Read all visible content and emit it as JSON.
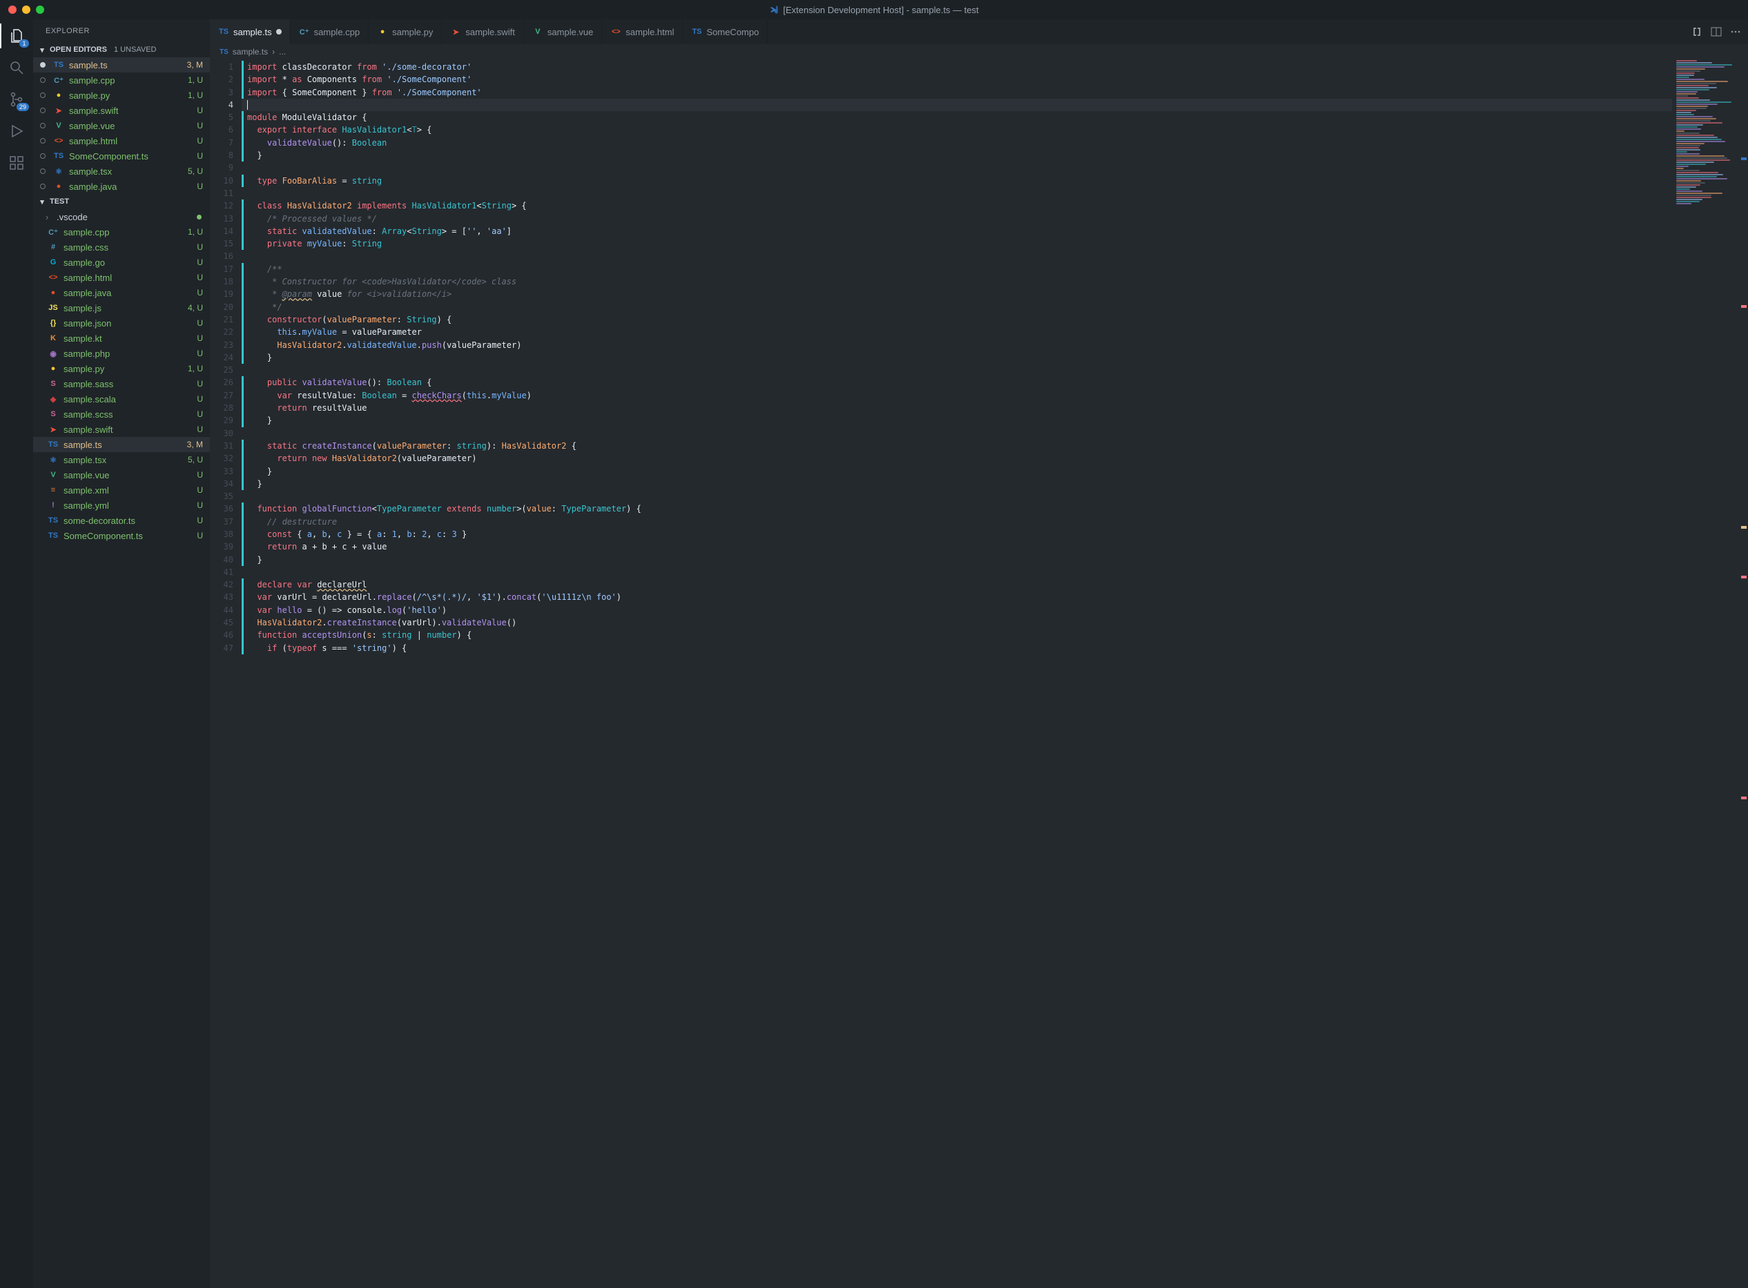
{
  "window": {
    "title": "[Extension Development Host] - sample.ts — test"
  },
  "activity": {
    "explorer_badge": "1",
    "scm_badge": "29"
  },
  "sidebar": {
    "title": "EXPLORER",
    "openEditors": {
      "label": "OPEN EDITORS",
      "unsaved": "1 UNSAVED"
    },
    "openEditorsItems": [
      {
        "name": "sample.ts",
        "icon": "TS",
        "iconClass": "ic-ts",
        "status": "3, M",
        "state": "modified",
        "dirty": true
      },
      {
        "name": "sample.cpp",
        "icon": "C⁺",
        "iconClass": "ic-cpp",
        "status": "1, U",
        "state": "untracked"
      },
      {
        "name": "sample.py",
        "icon": "●",
        "iconClass": "ic-py",
        "status": "1, U",
        "state": "untracked"
      },
      {
        "name": "sample.swift",
        "icon": "➤",
        "iconClass": "ic-swift",
        "status": "U",
        "state": "untracked"
      },
      {
        "name": "sample.vue",
        "icon": "V",
        "iconClass": "ic-vue",
        "status": "U",
        "state": "untracked"
      },
      {
        "name": "sample.html",
        "icon": "<>",
        "iconClass": "ic-html",
        "status": "U",
        "state": "untracked"
      },
      {
        "name": "SomeComponent.ts",
        "icon": "TS",
        "iconClass": "ic-ts",
        "status": "U",
        "state": "untracked"
      },
      {
        "name": "sample.tsx",
        "icon": "⚛",
        "iconClass": "ic-tsx",
        "status": "5, U",
        "state": "untracked"
      },
      {
        "name": "sample.java",
        "icon": "●",
        "iconClass": "ic-java",
        "status": "U",
        "state": "untracked"
      }
    ],
    "testSection": {
      "label": "TEST"
    },
    "folders": [
      {
        "name": ".vscode"
      }
    ],
    "files": [
      {
        "name": "sample.cpp",
        "icon": "C⁺",
        "iconClass": "ic-cpp",
        "status": "1, U",
        "state": "untracked"
      },
      {
        "name": "sample.css",
        "icon": "#",
        "iconClass": "ic-css",
        "status": "U",
        "state": "untracked"
      },
      {
        "name": "sample.go",
        "icon": "G",
        "iconClass": "ic-go",
        "status": "U",
        "state": "untracked"
      },
      {
        "name": "sample.html",
        "icon": "<>",
        "iconClass": "ic-html",
        "status": "U",
        "state": "untracked"
      },
      {
        "name": "sample.java",
        "icon": "●",
        "iconClass": "ic-java",
        "status": "U",
        "state": "untracked"
      },
      {
        "name": "sample.js",
        "icon": "JS",
        "iconClass": "ic-js",
        "status": "4, U",
        "state": "untracked"
      },
      {
        "name": "sample.json",
        "icon": "{}",
        "iconClass": "ic-json",
        "status": "U",
        "state": "untracked"
      },
      {
        "name": "sample.kt",
        "icon": "K",
        "iconClass": "ic-kt",
        "status": "U",
        "state": "untracked"
      },
      {
        "name": "sample.php",
        "icon": "◉",
        "iconClass": "ic-php",
        "status": "U",
        "state": "untracked"
      },
      {
        "name": "sample.py",
        "icon": "●",
        "iconClass": "ic-py",
        "status": "1, U",
        "state": "untracked"
      },
      {
        "name": "sample.sass",
        "icon": "S",
        "iconClass": "ic-sass",
        "status": "U",
        "state": "untracked"
      },
      {
        "name": "sample.scala",
        "icon": "◆",
        "iconClass": "ic-scala",
        "status": "U",
        "state": "untracked"
      },
      {
        "name": "sample.scss",
        "icon": "S",
        "iconClass": "ic-scss",
        "status": "U",
        "state": "untracked"
      },
      {
        "name": "sample.swift",
        "icon": "➤",
        "iconClass": "ic-swift",
        "status": "U",
        "state": "untracked"
      },
      {
        "name": "sample.ts",
        "icon": "TS",
        "iconClass": "ic-ts",
        "status": "3, M",
        "state": "modified",
        "selected": true
      },
      {
        "name": "sample.tsx",
        "icon": "⚛",
        "iconClass": "ic-tsx",
        "status": "5, U",
        "state": "untracked"
      },
      {
        "name": "sample.vue",
        "icon": "V",
        "iconClass": "ic-vue",
        "status": "U",
        "state": "untracked"
      },
      {
        "name": "sample.xml",
        "icon": "≡",
        "iconClass": "ic-xml",
        "status": "U",
        "state": "untracked"
      },
      {
        "name": "sample.yml",
        "icon": "!",
        "iconClass": "ic-yml",
        "status": "U",
        "state": "untracked"
      },
      {
        "name": "some-decorator.ts",
        "icon": "TS",
        "iconClass": "ic-ts",
        "status": "U",
        "state": "untracked"
      },
      {
        "name": "SomeComponent.ts",
        "icon": "TS",
        "iconClass": "ic-ts",
        "status": "U",
        "state": "untracked"
      }
    ]
  },
  "tabs": [
    {
      "label": "sample.ts",
      "icon": "TS",
      "iconClass": "ic-ts",
      "active": true,
      "dirty": true
    },
    {
      "label": "sample.cpp",
      "icon": "C⁺",
      "iconClass": "ic-cpp"
    },
    {
      "label": "sample.py",
      "icon": "●",
      "iconClass": "ic-py"
    },
    {
      "label": "sample.swift",
      "icon": "➤",
      "iconClass": "ic-swift"
    },
    {
      "label": "sample.vue",
      "icon": "V",
      "iconClass": "ic-vue"
    },
    {
      "label": "sample.html",
      "icon": "<>",
      "iconClass": "ic-html"
    },
    {
      "label": "SomeCompo",
      "icon": "TS",
      "iconClass": "ic-ts"
    }
  ],
  "breadcrumb": {
    "icon": "TS",
    "file": "sample.ts",
    "sep": "›",
    "rest": "..."
  },
  "code": {
    "activeLine": 4,
    "lines": [
      {
        "n": 1,
        "bar": true,
        "html": "<span class='kw'>import</span> <span class='id'>classDecorator</span> <span class='kw'>from</span> <span class='str'>'./some-decorator'</span>"
      },
      {
        "n": 2,
        "bar": true,
        "html": "<span class='kw'>import</span> <span class='pun'>*</span> <span class='kw'>as</span> <span class='id'>Components</span> <span class='kw'>from</span> <span class='str'>'./SomeComponent'</span>"
      },
      {
        "n": 3,
        "bar": true,
        "html": "<span class='kw'>import</span> <span class='pun'>{</span> <span class='id'>SomeComponent</span> <span class='pun'>}</span> <span class='kw'>from</span> <span class='str'>'./SomeComponent'</span>"
      },
      {
        "n": 4,
        "hl": true,
        "html": "<span class='pun' style='border-left:1px solid #e6edf3;'></span>"
      },
      {
        "n": 5,
        "bar": true,
        "html": "<span class='kw'>module</span> <span class='id'>ModuleValidator</span> <span class='pun'>{</span>"
      },
      {
        "n": 6,
        "bar": true,
        "html": "  <span class='kw'>export</span> <span class='kw'>interface</span> <span class='type'>HasValidator1</span><span class='pun'>&lt;</span><span class='type' style='opacity:.7'>T</span><span class='pun'>&gt; {</span>"
      },
      {
        "n": 7,
        "bar": true,
        "html": "    <span class='fn'>validateValue</span><span class='pun'>():</span> <span class='type'>Boolean</span>"
      },
      {
        "n": 8,
        "bar": true,
        "html": "  <span class='pun'>}</span>"
      },
      {
        "n": 9,
        "html": ""
      },
      {
        "n": 10,
        "bar": true,
        "html": "  <span class='kw'>type</span> <span class='cls'>FooBarAlias</span> <span class='pun'>=</span> <span class='type'>string</span>"
      },
      {
        "n": 11,
        "html": ""
      },
      {
        "n": 12,
        "bar": true,
        "html": "  <span class='kw'>class</span> <span class='cls'>HasValidator2</span> <span class='kw'>implements</span> <span class='type'>HasValidator1</span><span class='pun'>&lt;</span><span class='type'>String</span><span class='pun'>&gt; {</span>"
      },
      {
        "n": 13,
        "bar": true,
        "html": "    <span class='cm'>/* Processed values */</span>"
      },
      {
        "n": 14,
        "bar": true,
        "html": "    <span class='kw'>static</span> <span class='prop'>validatedValue</span><span class='pun'>:</span> <span class='type'>Array</span><span class='pun'>&lt;</span><span class='type'>String</span><span class='pun'>&gt; = [</span><span class='str'>''</span><span class='pun'>,</span> <span class='str'>'aa'</span><span class='pun'>]</span>"
      },
      {
        "n": 15,
        "bar": true,
        "html": "    <span class='kw'>private</span> <span class='prop'>myValue</span><span class='pun'>:</span> <span class='type'>String</span>"
      },
      {
        "n": 16,
        "html": ""
      },
      {
        "n": 17,
        "bar": true,
        "html": "    <span class='cm'>/**</span>"
      },
      {
        "n": 18,
        "bar": true,
        "html": "     <span class='cm'>* Constructor for &lt;code&gt;HasValidator&lt;/code&gt; class</span>"
      },
      {
        "n": 19,
        "bar": true,
        "html": "     <span class='cm'>* <span class='warn'>@param</span> <span style='color:#e6edf3;font-style:normal'>value</span> for &lt;i&gt;validation&lt;/i&gt;</span>"
      },
      {
        "n": 20,
        "bar": true,
        "html": "     <span class='cm'>*/</span>"
      },
      {
        "n": 21,
        "bar": true,
        "html": "    <span class='kw'>constructor</span><span class='pun'>(</span><span class='param'>valueParameter</span><span class='pun'>:</span> <span class='type'>String</span><span class='pun'>) {</span>"
      },
      {
        "n": 22,
        "bar": true,
        "html": "      <span class='this'>this</span><span class='pun'>.</span><span class='prop'>myValue</span> <span class='pun'>=</span> <span class='id'>valueParameter</span>"
      },
      {
        "n": 23,
        "bar": true,
        "html": "      <span class='cls'>HasValidator2</span><span class='pun'>.</span><span class='prop'>validatedValue</span><span class='pun'>.</span><span class='fn'>push</span><span class='pun'>(</span><span class='id'>valueParameter</span><span class='pun'>)</span>"
      },
      {
        "n": 24,
        "bar": true,
        "html": "    <span class='pun'>}</span>"
      },
      {
        "n": 25,
        "html": ""
      },
      {
        "n": 26,
        "bar": true,
        "html": "    <span class='kw'>public</span> <span class='fn'>validateValue</span><span class='pun'>():</span> <span class='type'>Boolean</span> <span class='pun'>{</span>"
      },
      {
        "n": 27,
        "bar": true,
        "html": "      <span class='kw'>var</span> <span class='id'>resultValue</span><span class='pun'>:</span> <span class='type'>Boolean</span> <span class='pun'>=</span> <span class='fn err'>checkChars</span><span class='pun'>(</span><span class='this'>this</span><span class='pun'>.</span><span class='prop'>myValue</span><span class='pun'>)</span>"
      },
      {
        "n": 28,
        "bar": true,
        "html": "      <span class='kw'>return</span> <span class='id'>resultValue</span>"
      },
      {
        "n": 29,
        "bar": true,
        "html": "    <span class='pun'>}</span>"
      },
      {
        "n": 30,
        "html": ""
      },
      {
        "n": 31,
        "bar": true,
        "html": "    <span class='kw'>static</span> <span class='fn'>createInstance</span><span class='pun'>(</span><span class='param'>valueParameter</span><span class='pun'>:</span> <span class='type'>string</span><span class='pun'>):</span> <span class='cls'>HasValidator2</span> <span class='pun'>{</span>"
      },
      {
        "n": 32,
        "bar": true,
        "html": "      <span class='kw'>return</span> <span class='kw'>new</span> <span class='cls'>HasValidator2</span><span class='pun'>(</span><span class='id'>valueParameter</span><span class='pun'>)</span>"
      },
      {
        "n": 33,
        "bar": true,
        "html": "    <span class='pun'>}</span>"
      },
      {
        "n": 34,
        "bar": true,
        "html": "  <span class='pun'>}</span>"
      },
      {
        "n": 35,
        "html": ""
      },
      {
        "n": 36,
        "bar": true,
        "html": "  <span class='kw'>function</span> <span class='fn'>globalFunction</span><span class='pun'>&lt;</span><span class='type'>TypeParameter</span> <span class='kw'>extends</span> <span class='type'>number</span><span class='pun'>&gt;(</span><span class='param'>value</span><span class='pun'>:</span> <span class='type'>TypeParameter</span><span class='pun'>) {</span>"
      },
      {
        "n": 37,
        "bar": true,
        "html": "    <span class='cm'>// destructure</span>"
      },
      {
        "n": 38,
        "bar": true,
        "html": "    <span class='kw'>const</span> <span class='pun'>{</span> <span class='const'>a</span><span class='pun'>,</span> <span class='const'>b</span><span class='pun'>,</span> <span class='const'>c</span> <span class='pun'>} = {</span> <span class='prop'>a</span><span class='pun'>:</span> <span class='num'>1</span><span class='pun'>,</span> <span class='prop'>b</span><span class='pun'>:</span> <span class='num'>2</span><span class='pun'>,</span> <span class='prop'>c</span><span class='pun'>:</span> <span class='num'>3</span> <span class='pun'>}</span>"
      },
      {
        "n": 39,
        "bar": true,
        "html": "    <span class='kw'>return</span> <span class='id'>a</span> <span class='pun'>+</span> <span class='id'>b</span> <span class='pun'>+</span> <span class='id'>c</span> <span class='pun'>+</span> <span class='id'>value</span>"
      },
      {
        "n": 40,
        "bar": true,
        "html": "  <span class='pun'>}</span>"
      },
      {
        "n": 41,
        "html": ""
      },
      {
        "n": 42,
        "bar": true,
        "html": "  <span class='kw'>declare</span> <span class='kw'>var</span> <span class='id warn'>declareUrl</span>"
      },
      {
        "n": 43,
        "bar": true,
        "html": "  <span class='kw'>var</span> <span class='id'>varUrl</span> <span class='pun'>=</span> <span class='id'>declareUrl</span><span class='pun'>.</span><span class='fn'>replace</span><span class='pun'>(</span><span class='str'>/^\\s*(.*)/</span><span class='pun'>,</span> <span class='str'>'$1'</span><span class='pun'>).</span><span class='fn'>concat</span><span class='pun'>(</span><span class='str'>'\\u1111z\\n foo'</span><span class='pun'>)</span>"
      },
      {
        "n": 44,
        "bar": true,
        "html": "  <span class='kw'>var</span> <span class='fn'>hello</span> <span class='pun'>= () =&gt;</span> <span class='id'>console</span><span class='pun'>.</span><span class='fn'>log</span><span class='pun'>(</span><span class='str'>'hello'</span><span class='pun'>)</span>"
      },
      {
        "n": 45,
        "bar": true,
        "html": "  <span class='cls'>HasValidator2</span><span class='pun'>.</span><span class='fn'>createInstance</span><span class='pun'>(</span><span class='id'>varUrl</span><span class='pun'>).</span><span class='fn'>validateValue</span><span class='pun'>()</span>"
      },
      {
        "n": 46,
        "bar": true,
        "html": "  <span class='kw'>function</span> <span class='fn'>acceptsUnion</span><span class='pun'>(</span><span class='param'>s</span><span class='pun'>:</span> <span class='type'>string</span> <span class='pun'>|</span> <span class='type'>number</span><span class='pun'>) {</span>"
      },
      {
        "n": 47,
        "bar": true,
        "html": "    <span class='kw'>if</span> <span class='pun'>(</span><span class='kw'>typeof</span> <span class='id'>s</span> <span class='pun'>===</span> <span class='str'>'string'</span><span class='pun'>) {</span>"
      }
    ]
  }
}
